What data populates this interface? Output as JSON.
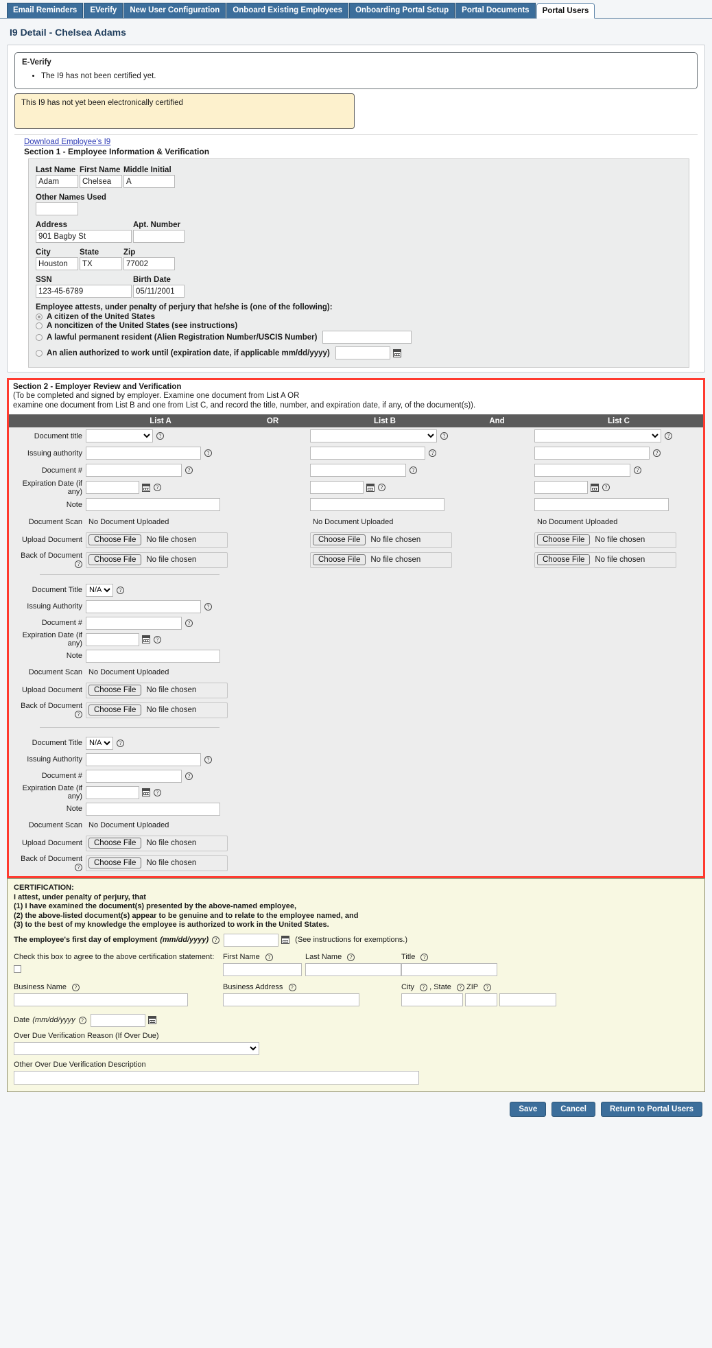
{
  "tabs": [
    {
      "label": "Email Reminders",
      "active": false
    },
    {
      "label": "EVerify",
      "active": false
    },
    {
      "label": "New User Configuration",
      "active": false
    },
    {
      "label": "Onboard Existing Employees",
      "active": false
    },
    {
      "label": "Onboarding Portal Setup",
      "active": false
    },
    {
      "label": "Portal Documents",
      "active": false
    },
    {
      "label": "Portal Users",
      "active": true
    }
  ],
  "page": {
    "title": "I9 Detail - Chelsea Adams"
  },
  "everify": {
    "heading": "E-Verify",
    "items": [
      "The I9 has not been certified yet."
    ],
    "banner": "This I9 has not yet been electronically certified"
  },
  "download_link": "Download Employee's I9",
  "section1": {
    "heading": "Section 1 - Employee Information & Verification",
    "labels": {
      "last_name": "Last Name",
      "first_name": "First Name",
      "middle_initial": "Middle Initial",
      "other_names": "Other Names Used",
      "address": "Address",
      "apt": "Apt. Number",
      "city": "City",
      "state": "State",
      "zip": "Zip",
      "ssn": "SSN",
      "birth_date": "Birth Date"
    },
    "values": {
      "last_name": "Adam",
      "first_name": "Chelsea",
      "middle_initial": "A",
      "other_names": "",
      "address": "901 Bagby St",
      "apt": "",
      "city": "Houston",
      "state": "TX",
      "zip": "77002",
      "ssn": "123-45-6789",
      "birth_date": "05/11/2001"
    },
    "attest_title": "Employee attests, under penalty of perjury that he/she is (one of the following):",
    "attest_options": [
      {
        "label": "A citizen of the United States",
        "selected": true,
        "field": false
      },
      {
        "label": "A noncitizen of the United States (see instructions)",
        "selected": false,
        "field": false
      },
      {
        "label": "A lawful permanent resident (Alien Registration Number/USCIS Number)",
        "selected": false,
        "field": true
      },
      {
        "label": "An alien authorized to work until (expiration date, if applicable mm/dd/yyyy)",
        "selected": false,
        "field": true,
        "calendar": true
      }
    ]
  },
  "section2": {
    "title": "Section 2 - Employer Review and Verification",
    "sub_line1": "(To be completed and signed by employer. Examine one document from List A OR",
    "sub_line2": "examine one document from List B and one from List C, and record the title, number, and expiration date, if any, of the document(s)).",
    "columns": {
      "list_a": "List A",
      "or": "OR",
      "list_b": "List B",
      "and": "And",
      "list_c": "List C"
    },
    "rows": {
      "document_title": "Document title",
      "issuing_authority": "Issuing authority",
      "document_number": "Document #",
      "expiration_date": "Expiration Date (if any)",
      "note": "Note",
      "document_scan": "Document Scan",
      "upload_document": "Upload Document",
      "back_of_document": "Back of Document"
    },
    "no_document_uploaded": "No Document Uploaded",
    "choose_file": "Choose File",
    "no_file_chosen": "No file chosen",
    "select_value": "",
    "extra_blocks": [
      {
        "document_title_label": "Document Title",
        "document_title_value": "N/A",
        "issuing_authority_label": "Issuing Authority",
        "document_number_label": "Document #",
        "expiration_label": "Expiration Date (if any)",
        "note_label": "Note",
        "scan_label": "Document Scan",
        "scan_value": "No Document Uploaded",
        "upload_label": "Upload Document",
        "back_label": "Back of Document"
      },
      {
        "document_title_label": "Document Title",
        "document_title_value": "N/A",
        "issuing_authority_label": "Issuing Authority",
        "document_number_label": "Document #",
        "expiration_label": "Expiration Date (if any)",
        "note_label": "Note",
        "scan_label": "Document Scan",
        "scan_value": "No Document Uploaded",
        "upload_label": "Upload Document",
        "back_label": "Back of Document"
      }
    ]
  },
  "certification": {
    "heading": "CERTIFICATION:",
    "line1": "I attest, under penalty of perjury, that",
    "line2": "(1) I have examined the document(s) presented by the above-named employee,",
    "line3": "(2) the above-listed document(s) appear to be genuine and to relate to the employee named, and",
    "line4": "(3) to the best of my knowledge the employee is authorized to work in the United States.",
    "first_day_label": "The employee's first day of employment",
    "first_day_format": "(mm/dd/yyyy)",
    "first_day_value": "",
    "see_instructions": "(See instructions for exemptions.)",
    "checkbox_label": "Check this box to agree to the above certification statement:",
    "first_name_label": "First Name",
    "last_name_label": "Last Name",
    "title_label": "Title",
    "first_name_value": "",
    "last_name_value": "",
    "title_value": "",
    "business_name_label": "Business Name",
    "business_name_value": "",
    "business_address_label": "Business Address",
    "business_address_value": "",
    "city_label": "City",
    "state_label": ", State",
    "zip_label": "ZIP",
    "city_value": "",
    "state_value": "",
    "zip_value": "",
    "date_label": "Date",
    "date_format": "(mm/dd/yyyy",
    "date_value": "",
    "overdue_reason_label": "Over Due Verification Reason (If Over Due)",
    "overdue_reason_value": "",
    "overdue_desc_label": "Other Over Due Verification Description",
    "overdue_desc_value": ""
  },
  "footer": {
    "save": "Save",
    "cancel": "Cancel",
    "return": "Return to Portal Users"
  }
}
